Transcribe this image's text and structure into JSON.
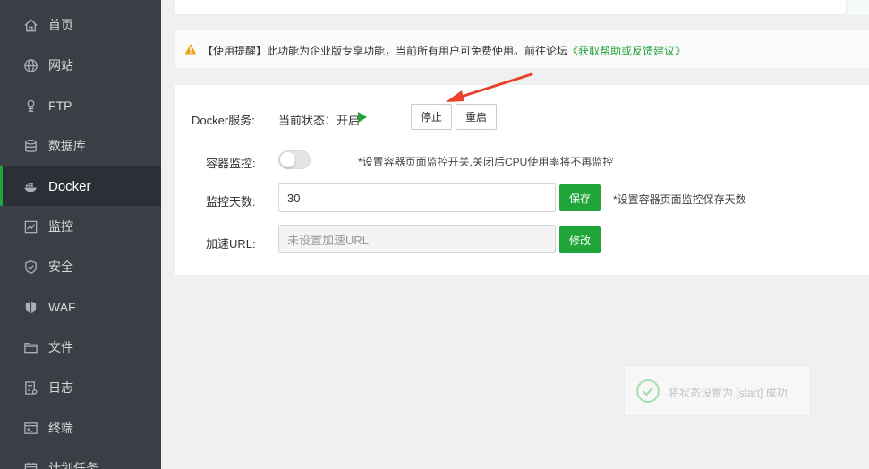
{
  "sidebar": {
    "items": [
      {
        "label": "首页",
        "icon": "home-icon"
      },
      {
        "label": "网站",
        "icon": "globe-icon"
      },
      {
        "label": "FTP",
        "icon": "ftp-icon"
      },
      {
        "label": "数据库",
        "icon": "database-icon"
      },
      {
        "label": "Docker",
        "icon": "docker-icon",
        "active": true
      },
      {
        "label": "监控",
        "icon": "monitor-icon"
      },
      {
        "label": "安全",
        "icon": "shield-icon"
      },
      {
        "label": "WAF",
        "icon": "waf-shield-icon"
      },
      {
        "label": "文件",
        "icon": "folder-icon"
      },
      {
        "label": "日志",
        "icon": "log-icon"
      },
      {
        "label": "终端",
        "icon": "terminal-icon"
      },
      {
        "label": "计划任务",
        "icon": "calendar-icon"
      }
    ]
  },
  "warning": {
    "text": "【使用提醒】此功能为企业版专享功能，当前所有用户可免费使用。前往论坛",
    "link": "《获取帮助或反馈建议》"
  },
  "docker_service": {
    "label": "Docker服务:",
    "status": "当前状态：开启",
    "stop_label": "停止",
    "restart_label": "重启"
  },
  "container_monitor": {
    "label": "容器监控:",
    "enabled": false,
    "hint": "*设置容器页面监控开关,关闭后CPU使用率将不再监控"
  },
  "monitor_days": {
    "label": "监控天数:",
    "value": "30",
    "save_label": "保存",
    "hint": "*设置容器页面监控保存天数"
  },
  "accel_url": {
    "label": "加速URL:",
    "value": "",
    "placeholder": "未设置加速URL",
    "modify_label": "修改"
  },
  "toast": {
    "text": "将状态设置为 [start] 成功"
  },
  "colors": {
    "sidebar_bg": "#3a3f46",
    "accent_green": "#20a53a",
    "warning_orange": "#f0a020",
    "arrow_red": "#e8412c"
  }
}
